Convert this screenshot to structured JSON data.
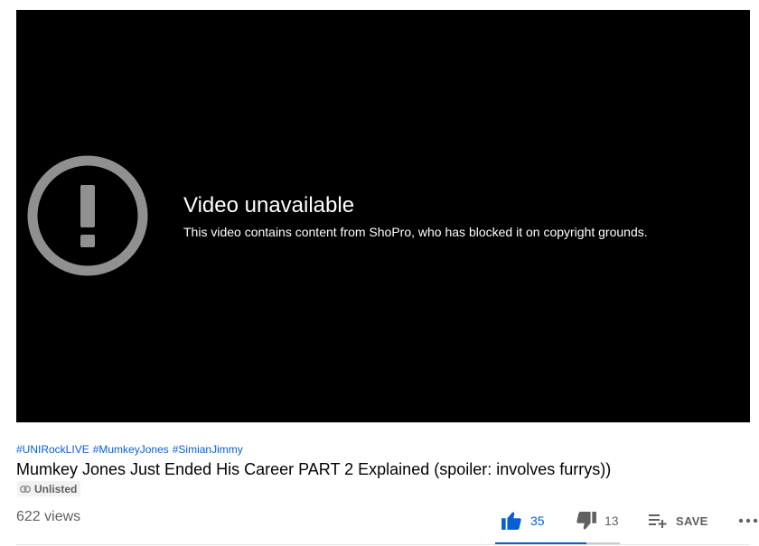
{
  "error": {
    "icon": "warning-circle-icon",
    "title": "Video unavailable",
    "message": "This video contains content from ShoPro, who has blocked it on copyright grounds."
  },
  "video": {
    "hashtags": [
      "#UNIRockLIVE",
      "#MumkeyJones",
      "#SimianJimmy"
    ],
    "title": "Mumkey Jones Just Ended His Career PART 2 Explained (spoiler: involves furrys))",
    "badge": {
      "icon": "link-icon",
      "label": "Unlisted"
    },
    "views": "622 views"
  },
  "actions": {
    "like": {
      "icon": "thumbs-up-icon",
      "count": "35"
    },
    "dislike": {
      "icon": "thumbs-down-icon",
      "count": "13"
    },
    "save": {
      "icon": "playlist-add-icon",
      "label": "SAVE"
    },
    "more": {
      "icon": "more-horizontal-icon"
    }
  },
  "sentiment": {
    "like_ratio": 0.729
  },
  "colors": {
    "accent": "#065fd4",
    "player_bg": "#000000",
    "icon_gray": "#909090"
  }
}
